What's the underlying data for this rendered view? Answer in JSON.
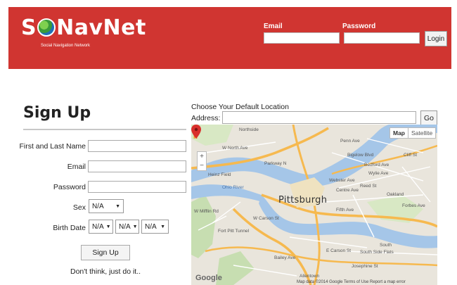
{
  "header": {
    "logo_text_pre": "S",
    "logo_text_post": "NavNet",
    "tagline": "Social Navigation Network",
    "email_label": "Email",
    "password_label": "Password",
    "login_button": "Login"
  },
  "signup": {
    "title": "Sign Up",
    "fields": {
      "name_label": "First and Last Name",
      "email_label": "Email",
      "password_label": "Password",
      "sex_label": "Sex",
      "birthdate_label": "Birth Date"
    },
    "sex_value": "N/A",
    "birth_month_value": "N/A",
    "birth_day_value": "N/A",
    "birth_year_value": "N/A",
    "submit_label": "Sign Up",
    "slogan": "Don't think, just do it.."
  },
  "location": {
    "title": "Choose Your Default Location",
    "address_label": "Address:",
    "address_value": "",
    "go_button": "Go"
  },
  "map": {
    "type_map": "Map",
    "type_satellite": "Satellite",
    "zoom_in": "+",
    "zoom_out": "−",
    "city": "Pittsburgh",
    "labels": {
      "northside": "Northside",
      "w_north_ave": "W North Ave",
      "heinz_field": "Heinz Field",
      "parkway_n": "Parkway N",
      "ohio_river": "Ohio River",
      "fifth_ave": "Fifth Ave",
      "e_carson": "E Carson St",
      "bailey_ave": "Bailey Ave",
      "josephine": "Josephine St",
      "allentown": "Allentown",
      "south_side_flats": "South Side Flats",
      "oakland": "Oakland",
      "forbes_ave": "Forbes Ave",
      "centre_ave": "Centre Ave",
      "bigelow_blvd": "Bigelow Blvd",
      "bedford_ave": "Bedford Ave",
      "wylie_ave": "Wylie Ave",
      "webster_ave": "Webster Ave",
      "reed_st": "Reed St",
      "penn_ave": "Penn Ave",
      "cliff_st": "Cliff St",
      "fort_pitt_tunnel": "Fort Pitt Tunnel",
      "w_carson_st": "W Carson St",
      "south": "South",
      "west_mifflin": "W Mifflin Rd"
    },
    "google": "Google",
    "attribution": "Map data ©2014 Google   Terms of Use   Report a map error"
  },
  "colors": {
    "header_bg": "#d03531",
    "water": "#a5c6e8",
    "highway": "#f6b94f",
    "land": "#e9e5dc",
    "park": "#c7deb1",
    "pin": "#d9302c"
  }
}
